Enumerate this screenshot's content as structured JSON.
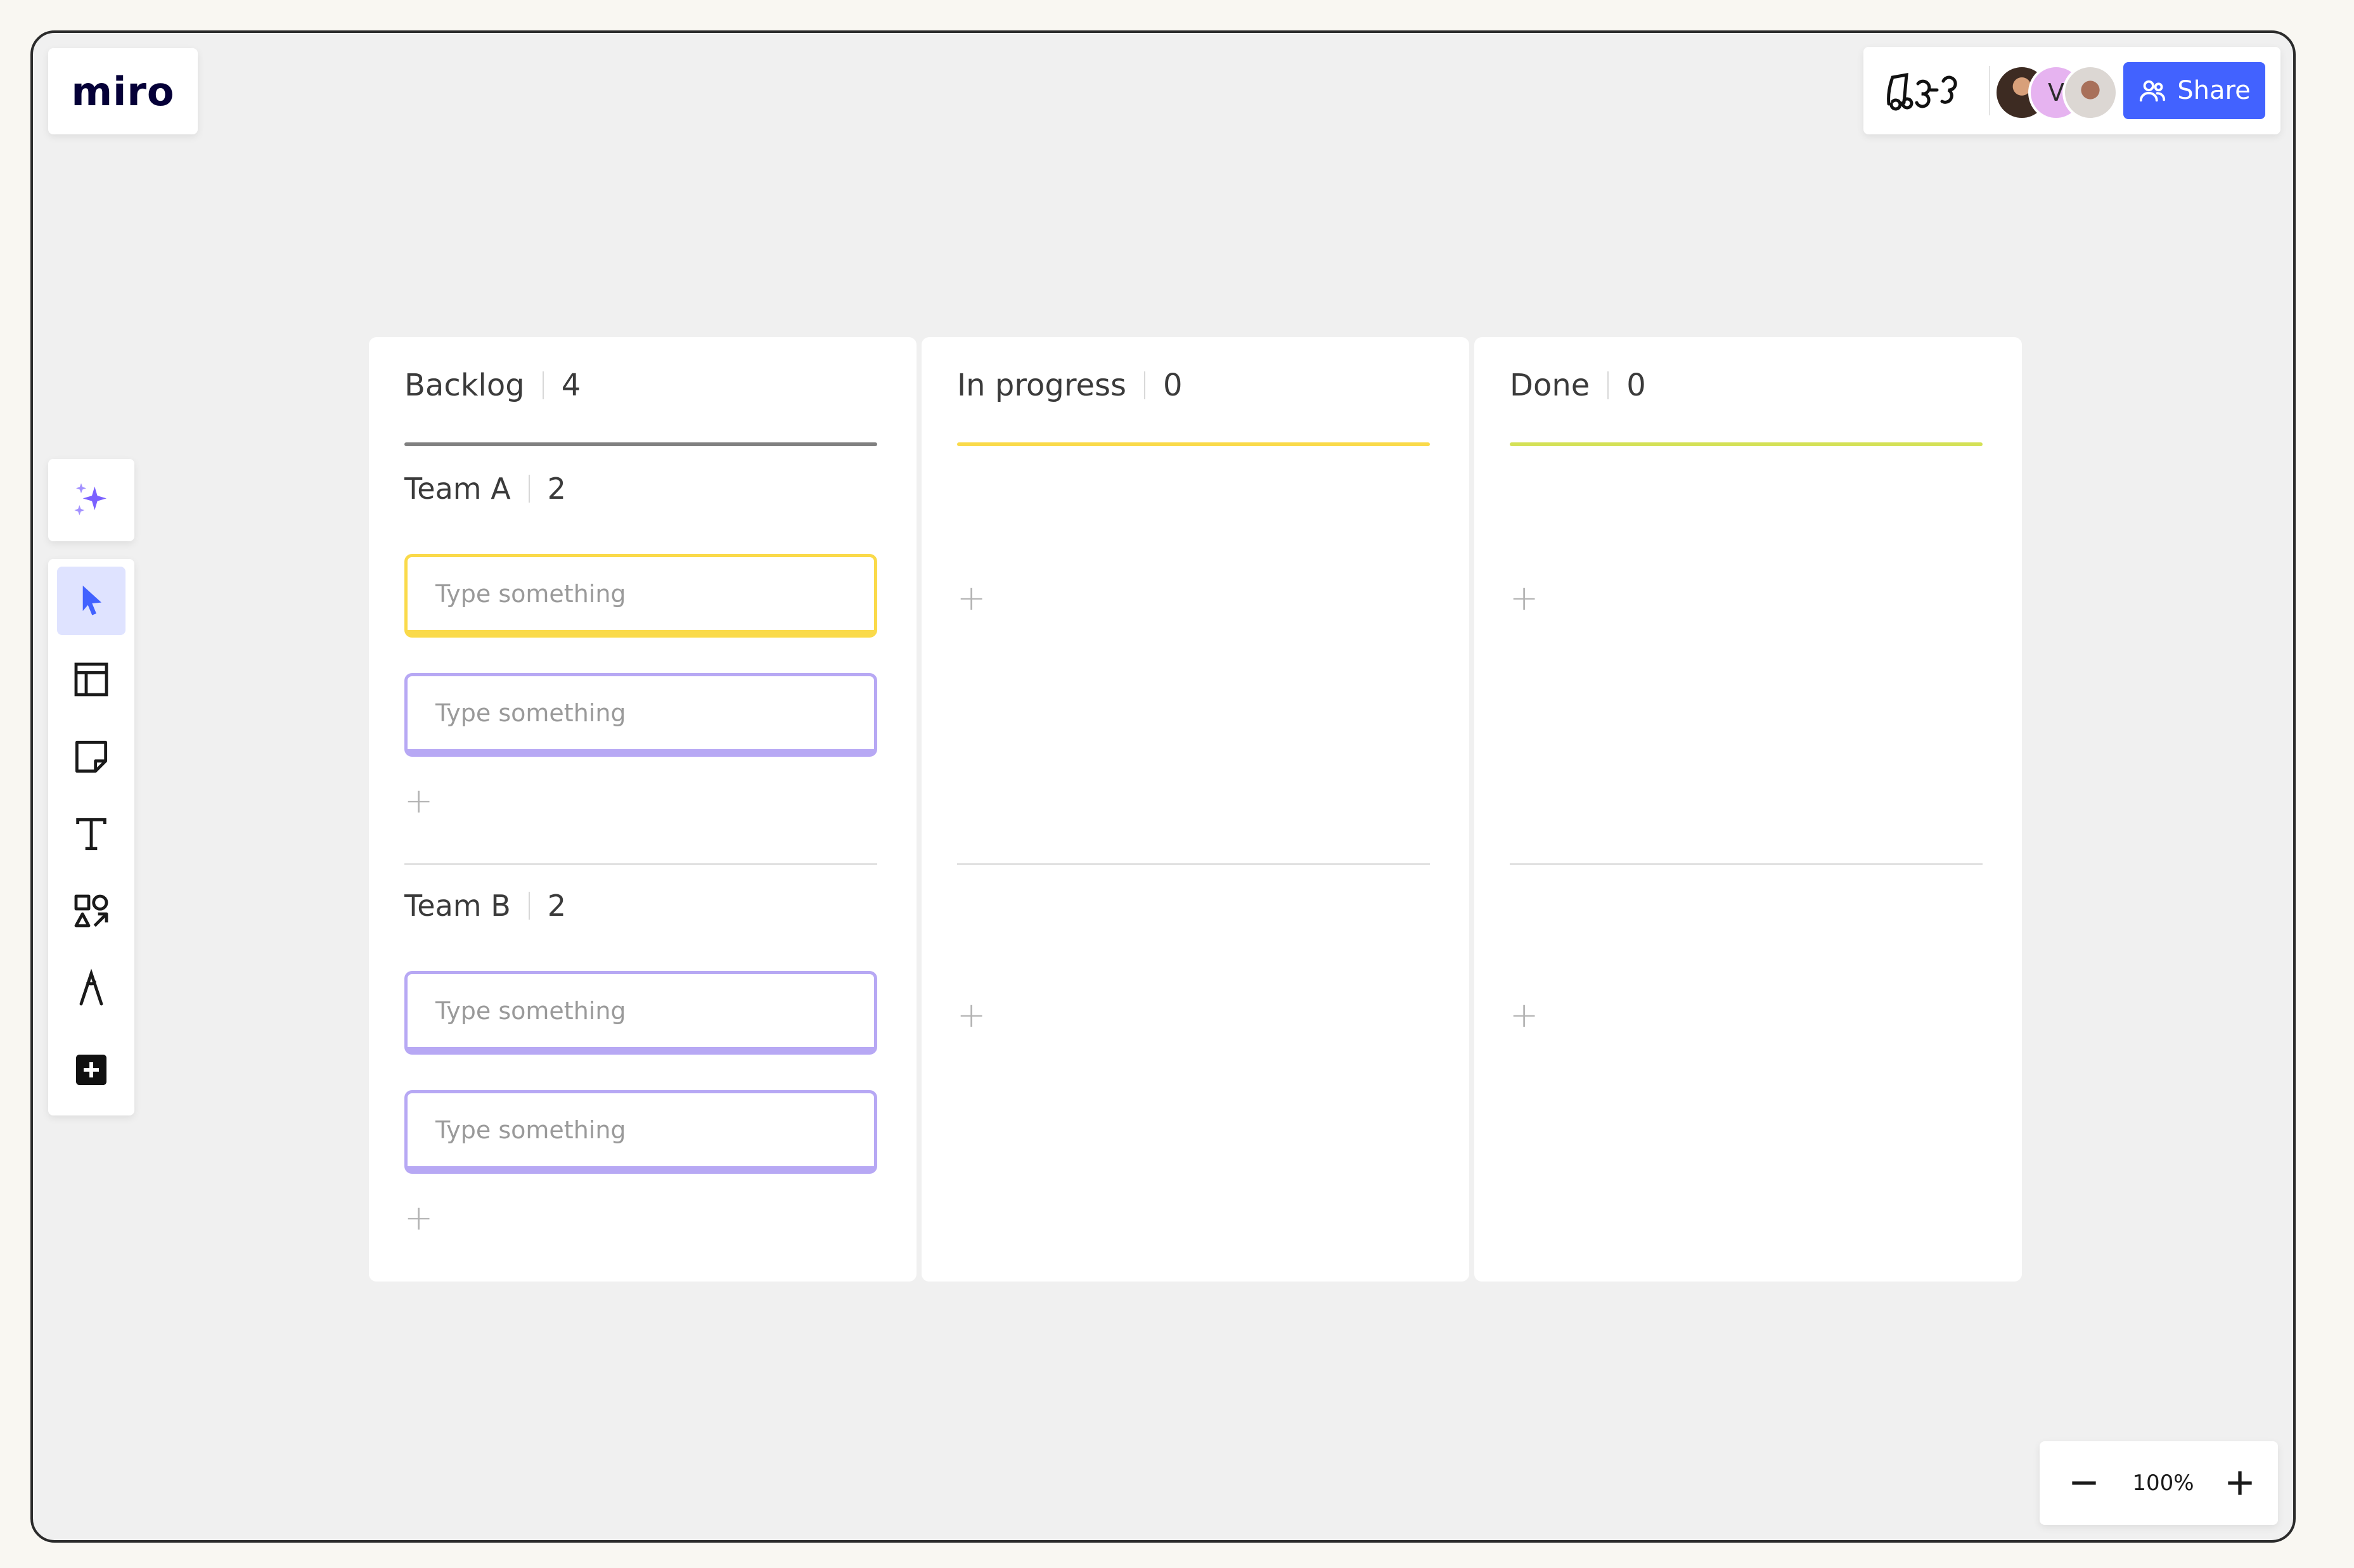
{
  "app": {
    "logo": "miro"
  },
  "topbar": {
    "board_icon": "board-doodle-icon",
    "avatars": [
      {
        "name": "avatar-photo-1",
        "initial": ""
      },
      {
        "name": "avatar-v",
        "initial": "V"
      },
      {
        "name": "avatar-photo-2",
        "initial": ""
      }
    ],
    "share_label": "Share",
    "share_color": "#4262ff"
  },
  "toolbar": {
    "ai_icon": "sparkle-icon",
    "tools": [
      {
        "name": "select-tool",
        "icon": "cursor-icon",
        "active": true
      },
      {
        "name": "templates-tool",
        "icon": "layout-icon",
        "active": false
      },
      {
        "name": "sticky-note-tool",
        "icon": "sticky-note-icon",
        "active": false
      },
      {
        "name": "text-tool",
        "icon": "text-icon",
        "active": false
      },
      {
        "name": "shapes-tool",
        "icon": "shapes-icon",
        "active": false
      },
      {
        "name": "pen-tool",
        "icon": "pen-icon",
        "active": false
      },
      {
        "name": "more-tools",
        "icon": "plus-square-icon",
        "active": false
      }
    ]
  },
  "board": {
    "columns": [
      {
        "title": "Backlog",
        "count": "4",
        "accent": "#808080"
      },
      {
        "title": "In progress",
        "count": "0",
        "accent": "#fada4a"
      },
      {
        "title": "Done",
        "count": "0",
        "accent": "#d4e157"
      }
    ],
    "groups": [
      {
        "title": "Team A",
        "count": "2",
        "cards": [
          {
            "placeholder": "Type something",
            "color": "#fada4a"
          },
          {
            "placeholder": "Type something",
            "color": "#b7a8f4"
          }
        ]
      },
      {
        "title": "Team B",
        "count": "2",
        "cards": [
          {
            "placeholder": "Type something",
            "color": "#b7a8f4"
          },
          {
            "placeholder": "Type something",
            "color": "#b7a8f4"
          }
        ]
      }
    ],
    "add_symbol": "+"
  },
  "zoom": {
    "level": "100%"
  }
}
